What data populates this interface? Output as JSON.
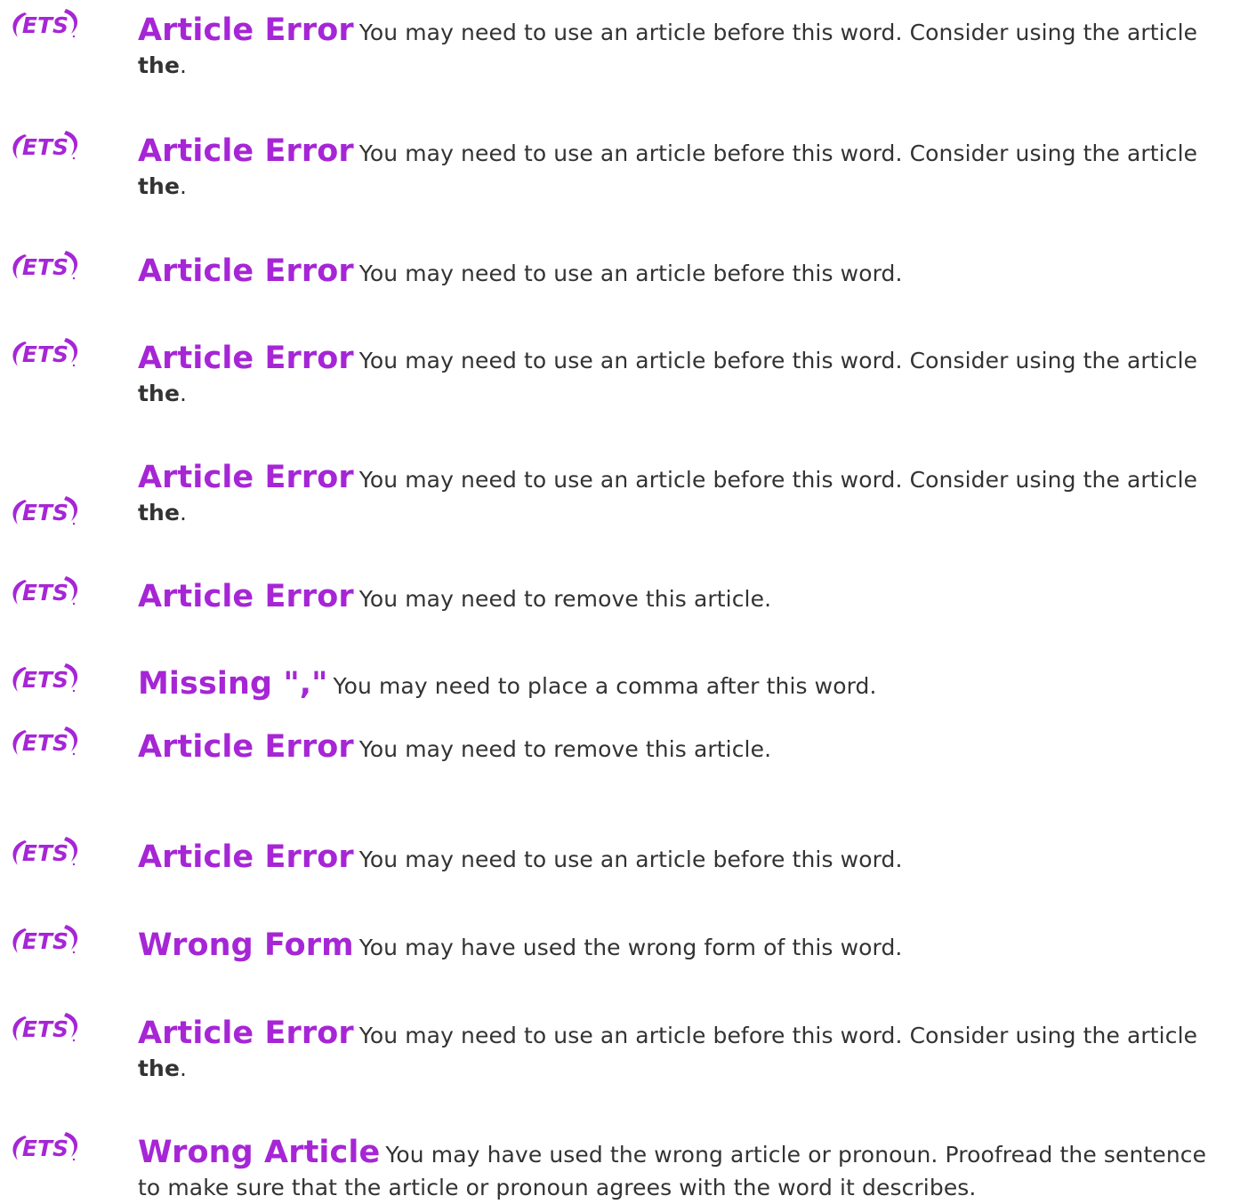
{
  "colors": {
    "accent": "#a626d6",
    "text": "#333333"
  },
  "logo_text": "ETS",
  "items": [
    {
      "title": "Article Error",
      "text": "You may need to use an article before this word. Consider using the article",
      "bold": "the",
      "tail": "."
    },
    {
      "title": "Article Error",
      "text": "You may need to use an article before this word. Consider using the article",
      "bold": "the",
      "tail": "."
    },
    {
      "title": "Article Error",
      "text": "You may need to use an article before this word.",
      "bold": "",
      "tail": ""
    },
    {
      "title": "Article Error",
      "text": "You may need to use an article before this word. Consider using the article",
      "bold": "the",
      "tail": "."
    },
    {
      "title": "Article Error",
      "text": "You may need to use an article before this word. Consider using the article",
      "bold": "the",
      "tail": "."
    },
    {
      "title": "Article Error",
      "text": "You may need to remove this article.",
      "bold": "",
      "tail": ""
    },
    {
      "title": "Missing \",\"",
      "text": "You may need to place a comma after this word.",
      "bold": "",
      "tail": ""
    },
    {
      "title": "Article Error",
      "text": "You may need to remove this article.",
      "bold": "",
      "tail": ""
    },
    {
      "title": "Article Error",
      "text": "You may need to use an article before this word.",
      "bold": "",
      "tail": ""
    },
    {
      "title": "Wrong Form",
      "text": "You may have used the wrong form of this word.",
      "bold": "",
      "tail": ""
    },
    {
      "title": "Article Error",
      "text": "You may need to use an article before this word. Consider using the article",
      "bold": "the",
      "tail": "."
    },
    {
      "title": "Wrong Article",
      "text": "You may have used the wrong article or pronoun. Proofread the sentence to make sure that the article or pronoun agrees with the word it describes.",
      "bold": "",
      "tail": ""
    }
  ]
}
